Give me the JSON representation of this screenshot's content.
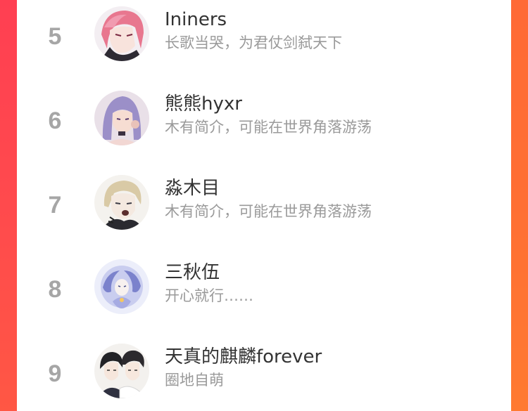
{
  "ranking": {
    "items": [
      {
        "rank": "5",
        "name": "Ininers",
        "bio": "长歌当哭，为君仗剑弑天下",
        "avatar_icon": "anime-avatar-pink-hair-icon"
      },
      {
        "rank": "6",
        "name": "熊熊hyxr",
        "bio": "木有简介，可能在世界角落游荡",
        "avatar_icon": "anime-avatar-purple-hair-icon"
      },
      {
        "rank": "7",
        "name": "淼木目",
        "bio": "木有简介，可能在世界角落游荡",
        "avatar_icon": "anime-avatar-blonde-hair-icon"
      },
      {
        "rank": "8",
        "name": "三秋伍",
        "bio": "开心就行……",
        "avatar_icon": "anime-avatar-blue-spirit-icon"
      },
      {
        "rank": "9",
        "name": "天真的麒麟forever",
        "bio": "圈地自萌",
        "avatar_icon": "anime-avatar-two-boys-icon"
      }
    ]
  },
  "colors": {
    "background_left": "#ff4a4f",
    "background_right": "#ff6f33",
    "card": "#ffffff",
    "rank_text": "#a6a6a6",
    "name_text": "#333333",
    "bio_text": "#9a9a9a"
  }
}
